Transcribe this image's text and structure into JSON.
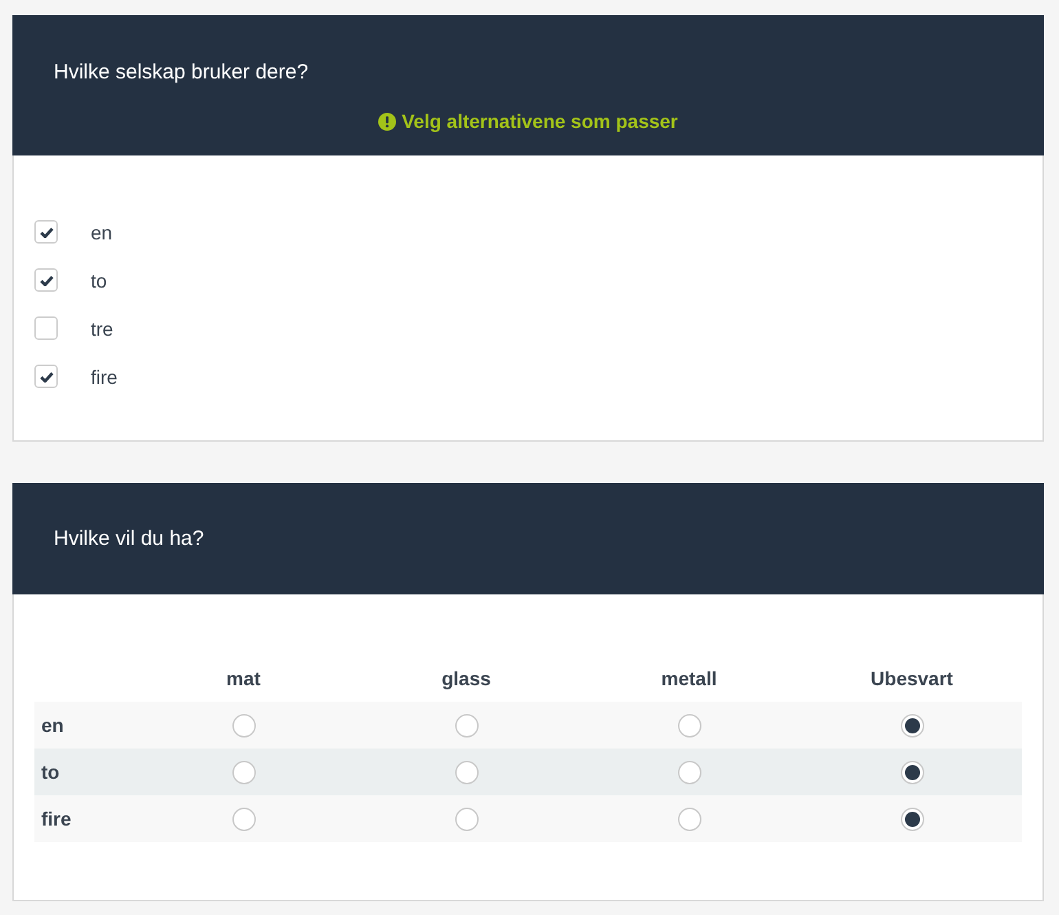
{
  "questions": [
    {
      "kind": "checkbox",
      "title": "Hvilke selskap bruker dere?",
      "hint": "Velg alternativene som passer",
      "options": [
        {
          "label": "en",
          "checked": true
        },
        {
          "label": "to",
          "checked": true
        },
        {
          "label": "tre",
          "checked": false
        },
        {
          "label": "fire",
          "checked": true
        }
      ]
    },
    {
      "kind": "matrix",
      "title": "Hvilke vil du ha?",
      "columns": [
        "mat",
        "glass",
        "metall",
        "Ubesvart"
      ],
      "rows": [
        {
          "label": "en",
          "choices": [
            {
              "selected": false
            },
            {
              "selected": false
            },
            {
              "selected": false
            },
            {
              "selected": true
            }
          ]
        },
        {
          "label": "to",
          "choices": [
            {
              "selected": false
            },
            {
              "selected": false
            },
            {
              "selected": false
            },
            {
              "selected": true
            }
          ]
        },
        {
          "label": "fire",
          "choices": [
            {
              "selected": false
            },
            {
              "selected": false
            },
            {
              "selected": false
            },
            {
              "selected": true
            }
          ]
        }
      ]
    }
  ]
}
